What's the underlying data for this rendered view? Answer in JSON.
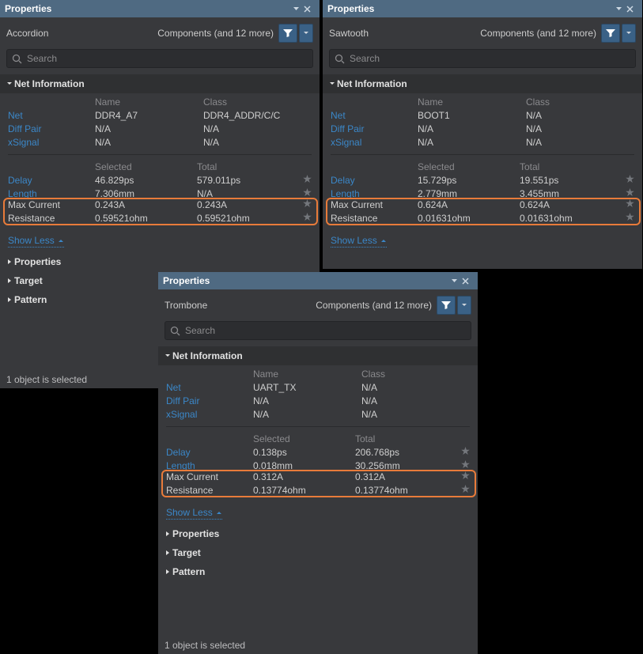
{
  "common": {
    "panelTitle": "Properties",
    "componentsLabel": "Components (and 12 more)",
    "searchPlaceholder": "Search",
    "netInfoHeader": "Net Information",
    "colName": "Name",
    "colClass": "Class",
    "colSelected": "Selected",
    "colTotal": "Total",
    "rowNet": "Net",
    "rowDiffPair": "Diff Pair",
    "rowXSignal": "xSignal",
    "rowDelay": "Delay",
    "rowLength": "Length",
    "rowMaxCurrent": "Max Current",
    "rowResistance": "Resistance",
    "showLess": "Show Less",
    "secProperties": "Properties",
    "secTarget": "Target",
    "secPattern": "Pattern",
    "status": "1 object is selected",
    "na": "N/A"
  },
  "panels": {
    "left": {
      "subname": "Accordion",
      "net": {
        "name": "DDR4_A7",
        "class": "DDR4_ADDR/C/C"
      },
      "delay": {
        "sel": "46.829ps",
        "tot": "579.011ps"
      },
      "length": {
        "sel": "7.306mm",
        "tot": "N/A"
      },
      "maxcur": {
        "sel": "0.243A",
        "tot": "0.243A"
      },
      "resist": {
        "sel": "0.59521ohm",
        "tot": "0.59521ohm"
      }
    },
    "right": {
      "subname": "Sawtooth",
      "net": {
        "name": "BOOT1",
        "class": "N/A"
      },
      "delay": {
        "sel": "15.729ps",
        "tot": "19.551ps"
      },
      "length": {
        "sel": "2.779mm",
        "tot": "3.455mm"
      },
      "maxcur": {
        "sel": "0.624A",
        "tot": "0.624A"
      },
      "resist": {
        "sel": "0.01631ohm",
        "tot": "0.01631ohm"
      }
    },
    "mid": {
      "subname": "Trombone",
      "net": {
        "name": "UART_TX",
        "class": "N/A"
      },
      "delay": {
        "sel": "0.138ps",
        "tot": "206.768ps"
      },
      "length": {
        "sel": "0.018mm",
        "tot": "30.256mm"
      },
      "maxcur": {
        "sel": "0.312A",
        "tot": "0.312A"
      },
      "resist": {
        "sel": "0.13774ohm",
        "tot": "0.13774ohm"
      }
    }
  }
}
